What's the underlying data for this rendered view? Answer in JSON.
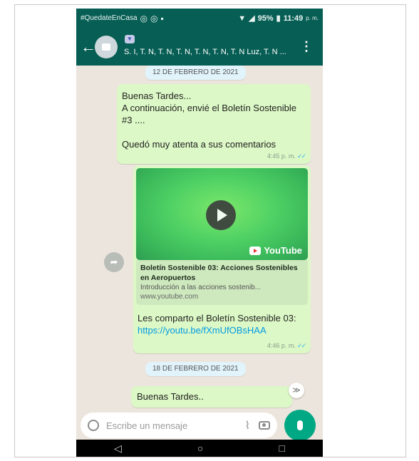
{
  "status_bar": {
    "hashtag": "#QuedateEnCasa",
    "battery": "95%",
    "time": "11:49",
    "time_suffix": "p. m."
  },
  "app_bar": {
    "title": "S. I, T. N, T. N, T. N, T. N, T. N, T. N Luz, T. N ..."
  },
  "chat": {
    "date_1": "12 DE FEBRERO DE 2021",
    "message_1": {
      "text": "Buenas Tardes...\nA continuación, envié el Boletín Sostenible #3 ....\n\nQuedó muy atenta a sus comentarios",
      "time": "4:45 p. m."
    },
    "message_2": {
      "link_title": "Boletín Sostenible 03: Acciones Sostenibles en Aeropuertos",
      "link_desc": "Introducción a las acciones sostenib...",
      "link_domain": "www.youtube.com",
      "brand": "YouTube",
      "text": "Les comparto el Boletín Sostenible 03: ",
      "url": "https://youtu.be/fXmUfOBsHAA",
      "time": "4:46 p. m."
    },
    "date_2": "18 DE FEBRERO DE 2021",
    "message_3": {
      "text": "Buenas Tardes.."
    }
  },
  "input_bar": {
    "placeholder": "Escribe un mensaje"
  },
  "nav": {
    "back": "◁",
    "home": "○",
    "recents": "□"
  },
  "icons": [
    "back-arrow-icon",
    "more-options-icon",
    "share-icon",
    "play-icon",
    "youtube-icon",
    "emoji-icon",
    "attach-icon",
    "camera-icon",
    "mic-icon",
    "scroll-down-icon"
  ],
  "colors": {
    "header": "#075e54",
    "chat_bg": "#ece5dd",
    "outgoing_bubble": "#dcf8c6",
    "date_chip": "#e1f3fb",
    "mic_button": "#00a884",
    "ticks": "#34b7f1"
  }
}
